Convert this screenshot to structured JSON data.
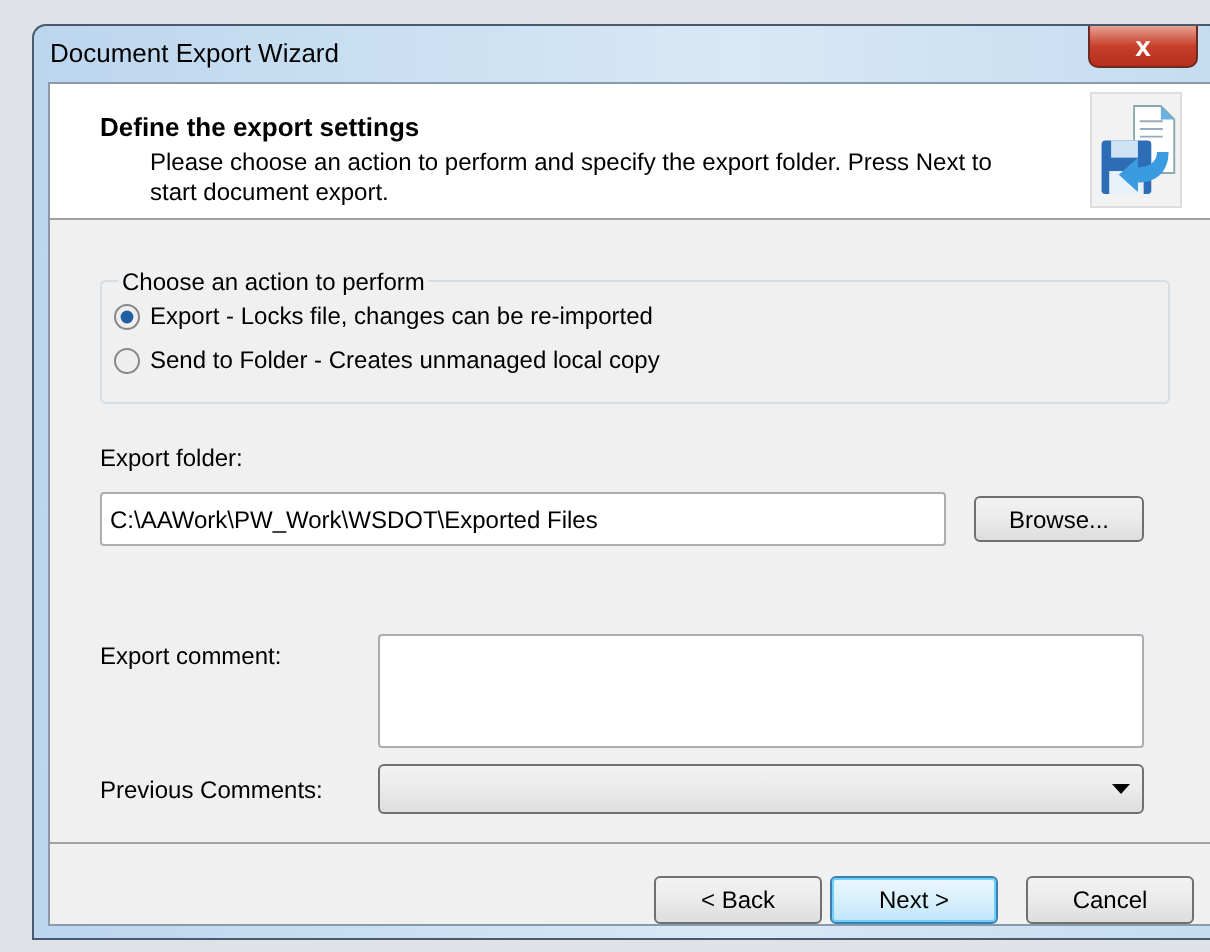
{
  "window": {
    "title": "Document Export Wizard",
    "close": "x"
  },
  "header": {
    "title": "Define the export settings",
    "description": "Please choose an action to perform and specify the export folder. Press Next to start document export."
  },
  "action_group": {
    "legend": "Choose an action to perform",
    "options": [
      {
        "label": "Export - Locks file, changes can be re-imported",
        "selected": true
      },
      {
        "label": "Send to Folder - Creates unmanaged local copy",
        "selected": false
      }
    ]
  },
  "export_folder": {
    "label": "Export folder:",
    "value": "C:\\AAWork\\PW_Work\\WSDOT\\Exported Files",
    "browse": "Browse..."
  },
  "export_comment": {
    "label": "Export comment:"
  },
  "previous_comments": {
    "label": "Previous Comments:"
  },
  "buttons": [
    {
      "label": "< Back",
      "default": false
    },
    {
      "label": "Next >",
      "default": true
    },
    {
      "label": "Cancel",
      "default": false
    }
  ]
}
